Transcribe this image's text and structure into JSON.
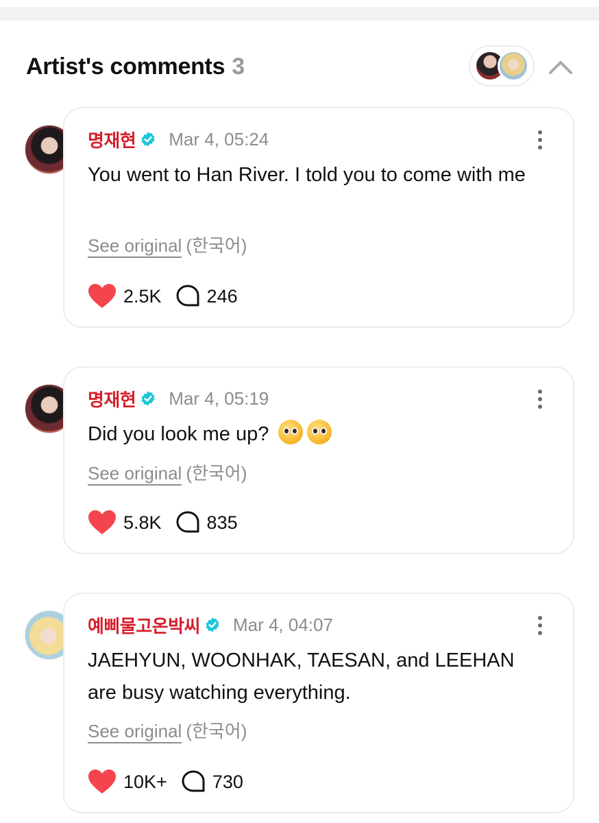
{
  "header": {
    "title": "Artist's comments",
    "count": "3"
  },
  "comments": [
    {
      "author": "명재현",
      "time": "Mar 4, 05:24",
      "text": "You went to Han River. I told you to come with me",
      "see_original": "See original",
      "language": "(한국어)",
      "likes": "2.5K",
      "replies": "246",
      "avatar": "dark-haired-avatar"
    },
    {
      "author": "명재현",
      "time": "Mar 4, 05:19",
      "text": "Did you look me up?",
      "emoji": [
        "pleading-face-emoji",
        "pleading-face-emoji"
      ],
      "see_original": "See original",
      "language": "(한국어)",
      "likes": "5.8K",
      "replies": "835",
      "avatar": "dark-haired-avatar"
    },
    {
      "author": "예삐물고온박씨",
      "time": "Mar 4, 04:07",
      "text": "JAEHYUN, WOONHAK, TAESAN, and LEEHAN are busy watching everything.",
      "see_original": "See original",
      "language": "(한국어)",
      "likes": "10K+",
      "replies": "730",
      "avatar": "blond-haired-avatar"
    }
  ],
  "colors": {
    "author": "#d51f2c",
    "verified": "#1ec6d9",
    "heart": "#f4454f",
    "muted": "#8c8c90",
    "card_border": "#ececef"
  }
}
